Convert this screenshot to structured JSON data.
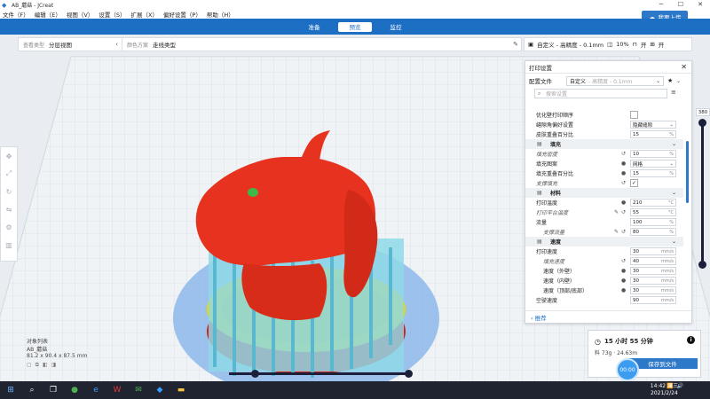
{
  "window": {
    "title": "AB_蘑菇 - JCreat"
  },
  "menu": [
    "文件（F）",
    "编辑（E）",
    "视图（V）",
    "设置（S）",
    "扩展（X）",
    "偏好设置（P）",
    "帮助（H）"
  ],
  "upload_label": "我要上传",
  "stages": [
    {
      "label": "准备",
      "active": false
    },
    {
      "label": "预览",
      "active": true
    },
    {
      "label": "监控",
      "active": false
    }
  ],
  "view_panel": {
    "view_type_label": "查看类型",
    "view_type_value": "分层视图",
    "color_scheme_label": "颜色方案",
    "color_scheme_value": "走线类型"
  },
  "right_bar": {
    "profile": "自定义 - 高精度 - 0.1mm",
    "infill": "10%",
    "support_icon": "support-icon",
    "adhesion_icon": "adhesion-icon"
  },
  "settings": {
    "title": "打印设置",
    "profile_label": "配置文件",
    "profile_value": "自定义",
    "profile_hint": "- 高精度 - 0.1mm",
    "search_placeholder": "搜索设置",
    "rows": [
      {
        "kind": "setting",
        "name": "优化壁打印顺序",
        "control": "check",
        "value": ""
      },
      {
        "kind": "setting",
        "name": "缝隙角偏好设置",
        "control": "select",
        "value": "隐藏缝隙"
      },
      {
        "kind": "setting",
        "name": "皮肤重叠百分比",
        "control": "field",
        "value": "15",
        "unit": "%"
      },
      {
        "kind": "category",
        "name": "填充",
        "icon": "infill-icon"
      },
      {
        "kind": "setting",
        "name": "填充密度",
        "italic": true,
        "reset": true,
        "control": "field",
        "value": "10",
        "unit": "%"
      },
      {
        "kind": "setting",
        "name": "填充图案",
        "link": true,
        "control": "select",
        "value": "网格"
      },
      {
        "kind": "setting",
        "name": "填充重叠百分比",
        "link": true,
        "control": "field",
        "value": "15",
        "unit": "%"
      },
      {
        "kind": "setting",
        "name": "支撑填充",
        "italic": true,
        "reset": true,
        "control": "check",
        "value": "✓"
      },
      {
        "kind": "category",
        "name": "材料",
        "icon": "material-icon"
      },
      {
        "kind": "setting",
        "name": "打印温度",
        "link": true,
        "control": "field",
        "value": "210",
        "unit": "°C"
      },
      {
        "kind": "setting",
        "name": "打印平台温度",
        "italic": true,
        "edit": true,
        "reset": true,
        "control": "field",
        "value": "55",
        "unit": "°C"
      },
      {
        "kind": "setting",
        "name": "流量",
        "control": "field",
        "value": "100",
        "unit": "%"
      },
      {
        "kind": "setting",
        "name": "支撑流量",
        "italic": true,
        "indent": true,
        "edit": true,
        "reset": true,
        "link": true,
        "control": "field",
        "value": "80",
        "unit": "%"
      },
      {
        "kind": "category",
        "name": "速度",
        "icon": "speed-icon"
      },
      {
        "kind": "setting",
        "name": "打印速度",
        "control": "field",
        "value": "30",
        "unit": "mm/s"
      },
      {
        "kind": "setting",
        "name": "填充速度",
        "italic": true,
        "indent": true,
        "reset": true,
        "control": "field",
        "value": "40",
        "unit": "mm/s"
      },
      {
        "kind": "setting",
        "name": "速度（外壁）",
        "indent": true,
        "link": true,
        "control": "field",
        "value": "30",
        "unit": "mm/s"
      },
      {
        "kind": "setting",
        "name": "速度（内壁）",
        "indent": true,
        "link": true,
        "control": "field",
        "value": "30",
        "unit": "mm/s"
      },
      {
        "kind": "setting",
        "name": "速度（顶部/底部）",
        "indent": true,
        "link": true,
        "control": "field",
        "value": "30",
        "unit": "mm/s"
      },
      {
        "kind": "setting",
        "name": "空驶速度",
        "control": "field",
        "value": "90",
        "unit": "mm/s"
      }
    ],
    "back_label": "推荐"
  },
  "layer_slider": {
    "value": "380"
  },
  "objects": {
    "title": "对象列表",
    "name": "AB_蘑菇",
    "dims": "81.2 x 90.4 x 87.5 mm"
  },
  "estimate": {
    "time": "15 小时 55 分钟",
    "material": "料 73g · 24.63m",
    "save_label": "保存到文件",
    "timer_label": "00:00"
  },
  "taskbar": {
    "time": "14:42 周三",
    "date": "2021/2/24"
  }
}
